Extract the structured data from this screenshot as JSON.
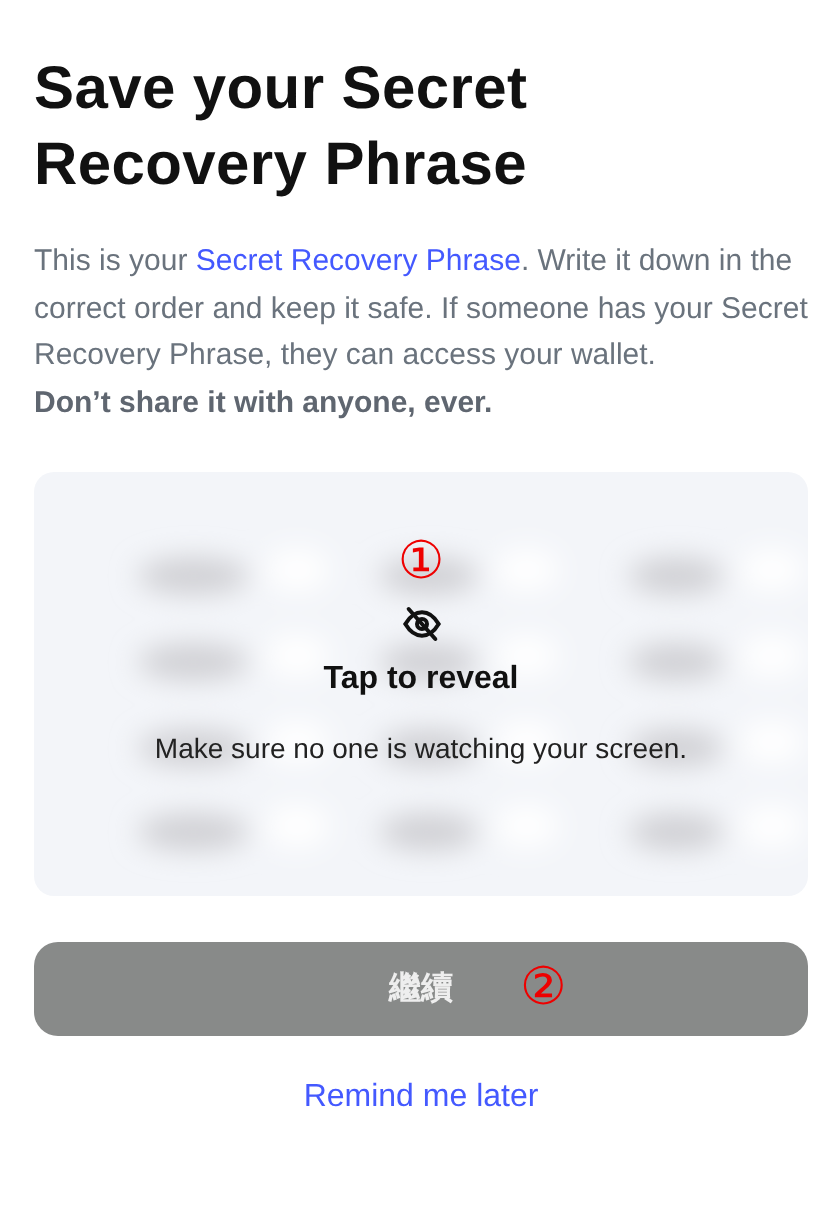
{
  "title": "Save your Secret Recovery Phrase",
  "intro": {
    "before": "This is your ",
    "link": "Secret Recovery Phrase",
    "after": ". Write it down in the correct order and keep it safe. If someone has your Secret Recovery Phrase, they can access your wallet."
  },
  "warning": "Don’t share it with anyone, ever.",
  "reveal_card": {
    "annotation": "①",
    "title": "Tap to reveal",
    "message": "Make sure no one is watching your screen."
  },
  "continue_button": {
    "label": "繼續",
    "disabled": true,
    "annotation": "②"
  },
  "remind_link": "Remind me later"
}
